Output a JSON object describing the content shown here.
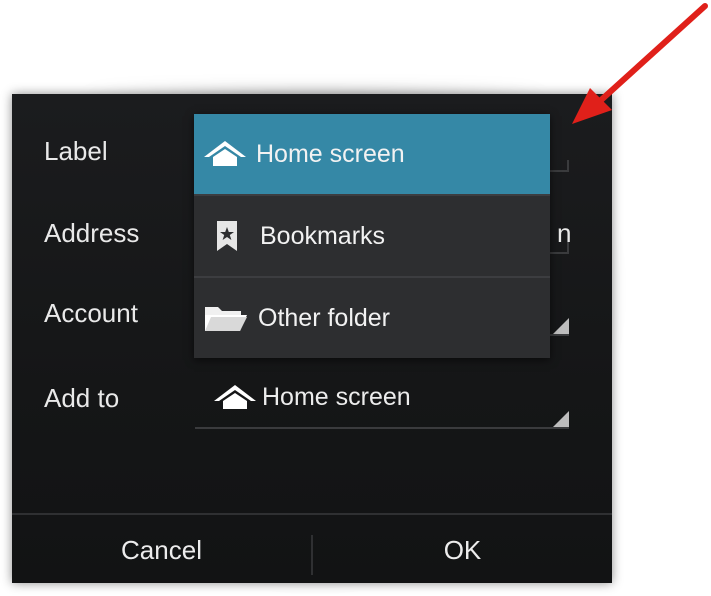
{
  "dialog": {
    "fields": {
      "label": "Label",
      "address": "Address",
      "account": "Account",
      "add_to": "Add to"
    },
    "address_value_fragment": "n",
    "add_to_value": "Home screen"
  },
  "dropdown": {
    "items": [
      {
        "label": "Home screen",
        "icon": "home-icon",
        "selected": true
      },
      {
        "label": "Bookmarks",
        "icon": "bookmark-icon",
        "selected": false
      },
      {
        "label": "Other folder",
        "icon": "folder-icon",
        "selected": false
      }
    ]
  },
  "buttons": {
    "cancel": "Cancel",
    "ok": "OK"
  },
  "colors": {
    "selected_item": "#3588a6",
    "dialog_bg": "#151617",
    "annotation_arrow": "#e0201a"
  }
}
